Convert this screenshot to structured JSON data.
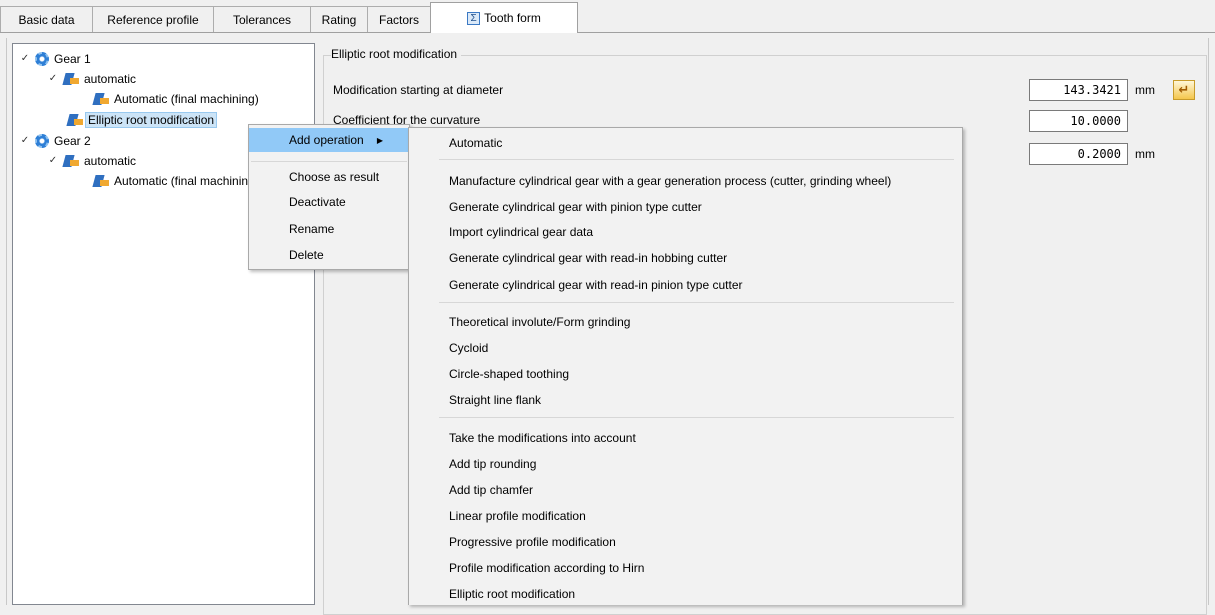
{
  "tabs": [
    {
      "label": "Basic data"
    },
    {
      "label": "Reference profile"
    },
    {
      "label": "Tolerances"
    },
    {
      "label": "Rating"
    },
    {
      "label": "Factors"
    },
    {
      "label": "Tooth form",
      "icon": "sigma-icon"
    }
  ],
  "tree": {
    "gear1": {
      "label": "Gear 1",
      "icon": "gear-icon"
    },
    "gear1_auto": {
      "label": "automatic",
      "icon": "operation-icon"
    },
    "gear1_final": {
      "label": "Automatic (final machining)",
      "icon": "operation-icon"
    },
    "gear1_elliptic": {
      "label": "Elliptic root modification",
      "icon": "operation-icon"
    },
    "gear2": {
      "label": "Gear 2",
      "icon": "gear-icon"
    },
    "gear2_auto": {
      "label": "automatic",
      "icon": "operation-icon"
    },
    "gear2_final": {
      "label": "Automatic (final machining)",
      "icon": "operation-icon"
    }
  },
  "panel": {
    "group_title": "Elliptic root modification",
    "fields": [
      {
        "label": "Modification starting at diameter",
        "value": "143.3421",
        "unit": "mm"
      },
      {
        "label": "Coefficient for the curvature",
        "value": "10.0000",
        "unit": ""
      },
      {
        "label": "",
        "value": "0.2000",
        "unit": "mm"
      }
    ]
  },
  "context_menu": {
    "items": [
      {
        "label": "Add operation",
        "has_submenu": true
      },
      {
        "label": "Choose as result"
      },
      {
        "label": "Deactivate"
      },
      {
        "label": "Rename"
      },
      {
        "label": "Delete"
      }
    ]
  },
  "submenu": {
    "items": [
      {
        "label": "Automatic"
      },
      {
        "label": "Manufacture cylindrical gear with a gear generation process (cutter, grinding wheel)"
      },
      {
        "label": "Generate cylindrical gear with pinion type cutter"
      },
      {
        "label": "Import cylindrical gear data"
      },
      {
        "label": "Generate cylindrical gear with read-in hobbing cutter"
      },
      {
        "label": "Generate cylindrical gear with read-in pinion type cutter"
      },
      {
        "label": "Theoretical involute/Form grinding"
      },
      {
        "label": "Cycloid"
      },
      {
        "label": "Circle-shaped toothing"
      },
      {
        "label": "Straight line flank"
      },
      {
        "label": "Take the modifications into account"
      },
      {
        "label": "Add tip rounding"
      },
      {
        "label": "Add tip chamfer"
      },
      {
        "label": "Linear profile modification"
      },
      {
        "label": "Progressive profile modification"
      },
      {
        "label": "Profile modification according to Hirn"
      },
      {
        "label": "Elliptic root modification"
      }
    ]
  },
  "colors": {
    "highlight": "#91c9f7",
    "selection": "#cce4f7",
    "accent_button": "#f4c64c"
  }
}
